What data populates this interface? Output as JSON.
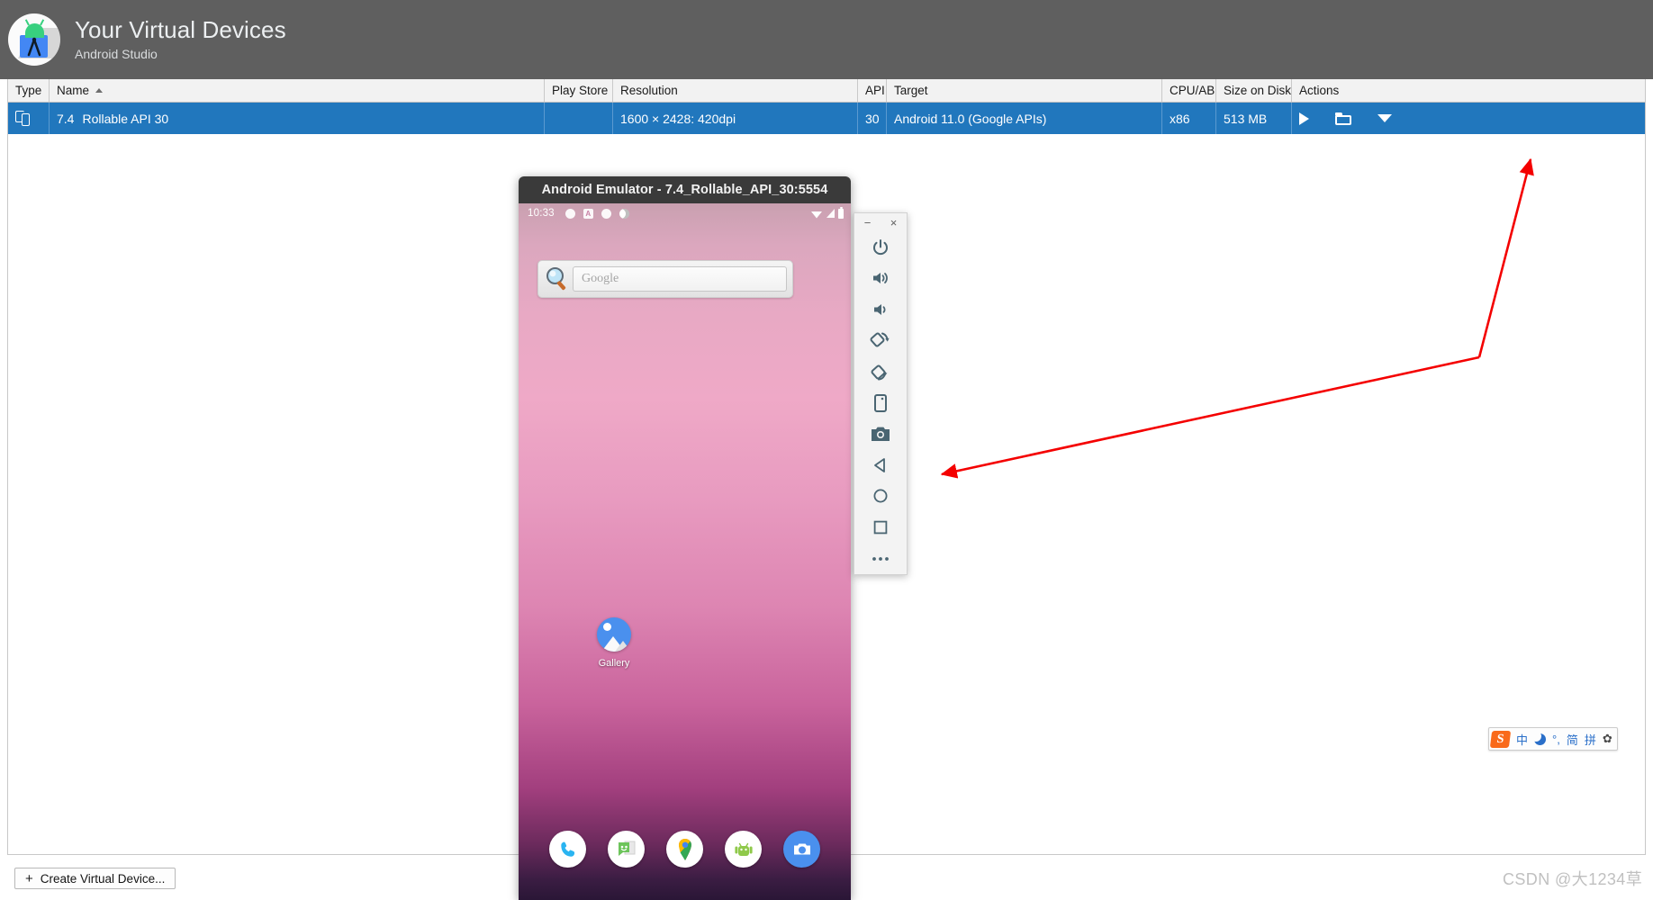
{
  "header": {
    "title": "Your Virtual Devices",
    "subtitle": "Android Studio",
    "logo_icon": "android-studio-logo-icon",
    "background_color": "#5f5f5f"
  },
  "table": {
    "columns": [
      {
        "key": "type",
        "label": "Type"
      },
      {
        "key": "name",
        "label": "Name",
        "sorted": "asc"
      },
      {
        "key": "play_store",
        "label": "Play Store"
      },
      {
        "key": "resolution",
        "label": "Resolution"
      },
      {
        "key": "api",
        "label": "API"
      },
      {
        "key": "target",
        "label": "Target"
      },
      {
        "key": "cpu_abi",
        "label": "CPU/ABI"
      },
      {
        "key": "size_on_disk",
        "label": "Size on Disk"
      },
      {
        "key": "actions",
        "label": "Actions"
      }
    ],
    "rows": [
      {
        "type_icon": "devices-icon",
        "name_version": "7.4",
        "name": "Rollable API 30",
        "play_store": "",
        "resolution": "1600 × 2428: 420dpi",
        "api": "30",
        "target": "Android 11.0 (Google APIs)",
        "cpu_abi": "x86",
        "size_on_disk": "513 MB",
        "selected": true,
        "actions": [
          {
            "name": "run-button",
            "icon": "play-icon"
          },
          {
            "name": "show-on-disk-button",
            "icon": "folder-icon"
          },
          {
            "name": "menu-button",
            "icon": "chevron-down-icon"
          }
        ]
      }
    ],
    "selection_color": "#2177bd"
  },
  "footer": {
    "create_button": "Create Virtual Device...",
    "create_button_icon": "plus-icon"
  },
  "emulator": {
    "window_title": "Android Emulator - 7.4_Rollable_API_30:5554",
    "status_bar": {
      "time": "10:33",
      "left_icons": [
        "notification-icon",
        "alarm-icon",
        "notification-icon-2",
        "dnd-icon"
      ],
      "right_icons": [
        "wifi-icon",
        "cellular-signal-icon",
        "battery-icon"
      ]
    },
    "search_widget": {
      "icon": "google-search-magnifier-icon",
      "placeholder": "Google"
    },
    "apps": [
      {
        "label": "Gallery",
        "icon": "gallery-icon"
      }
    ],
    "dock": [
      {
        "name": "phone",
        "icon": "phone-icon"
      },
      {
        "name": "messages",
        "icon": "messages-icon"
      },
      {
        "name": "maps",
        "icon": "maps-icon"
      },
      {
        "name": "play-store",
        "icon": "android-icon"
      },
      {
        "name": "camera",
        "icon": "camera-icon"
      }
    ],
    "toolbar": {
      "window_buttons": [
        {
          "name": "minimize-button",
          "glyph": "−"
        },
        {
          "name": "close-button",
          "glyph": "×"
        }
      ],
      "buttons": [
        {
          "name": "power-button",
          "icon": "power-icon"
        },
        {
          "name": "volume-up-button",
          "icon": "volume-up-icon"
        },
        {
          "name": "volume-down-button",
          "icon": "volume-down-icon"
        },
        {
          "name": "rotate-left-button",
          "icon": "rotate-left-icon"
        },
        {
          "name": "rotate-right-button",
          "icon": "rotate-right-icon"
        },
        {
          "name": "fold-device-button",
          "icon": "device-frame-icon"
        },
        {
          "name": "screenshot-button",
          "icon": "camera-icon"
        },
        {
          "name": "back-button",
          "icon": "triangle-back-icon"
        },
        {
          "name": "home-button",
          "icon": "circle-home-icon"
        },
        {
          "name": "overview-button",
          "icon": "square-overview-icon"
        },
        {
          "name": "more-button",
          "icon": "ellipsis-icon"
        }
      ]
    }
  },
  "annotations": {
    "arrow_color": "#f40000",
    "arrows": [
      {
        "name": "arrow-to-run-button"
      },
      {
        "name": "arrow-to-emulator-window"
      }
    ]
  },
  "ime": {
    "logo": "S",
    "items": [
      {
        "name": "language-mode",
        "label": "中"
      },
      {
        "name": "moon-mode",
        "label": ""
      },
      {
        "name": "punctuation-mode",
        "label": "°,"
      },
      {
        "name": "simplified-mode",
        "label": "简"
      },
      {
        "name": "pinyin-mode",
        "label": "拼"
      },
      {
        "name": "settings",
        "label": "✿"
      }
    ]
  },
  "watermark": {
    "text": "CSDN @大1234草"
  }
}
